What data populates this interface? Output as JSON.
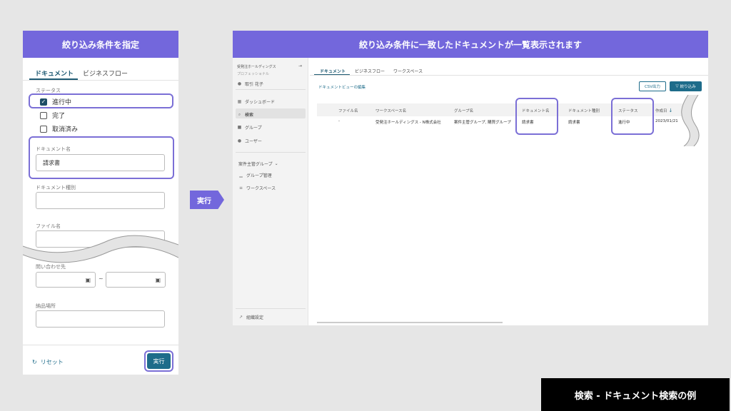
{
  "left_panel": {
    "header": "絞り込み条件を指定",
    "tabs": [
      "ドキュメント",
      "ビジネスフロー"
    ],
    "status_label": "ステータス",
    "status_options": [
      {
        "label": "進行中",
        "checked": true
      },
      {
        "label": "完了",
        "checked": false
      },
      {
        "label": "取消済み",
        "checked": false
      }
    ],
    "doc_name_label": "ドキュメント名",
    "doc_name_value": "請求書",
    "doc_type_label": "ドキュメント種別",
    "file_name_label": "ファイル名",
    "inquiry_label": "問い合わせ先",
    "range_separator": "~",
    "delivery_label": "納品場所",
    "reset_label": "リセット",
    "run_label": "実行"
  },
  "arrow_label": "実行",
  "right_panel": {
    "header": "絞り込み条件に一致したドキュメントが一覧表示されます",
    "sidebar": {
      "org_name": "受発注ホールディングス",
      "org_sub": "プロフェッショナル",
      "user": "取引 花子",
      "items": [
        "ダッシュボード",
        "検索",
        "グループ"
      ],
      "items2": [
        "ユーザー"
      ],
      "group_header": "案件主管グループ",
      "group_items": [
        "グループ管理",
        "ワークスペース"
      ],
      "footer": "組織設定"
    },
    "tabs": [
      "ドキュメント",
      "ビジネスフロー",
      "ワークスペース"
    ],
    "edit_view_link": "ドキュメントビューの編集",
    "csv_button": "CSV出力",
    "filter_button": "絞り込み",
    "table": {
      "headers": [
        "ファイル名",
        "ワークスペース名",
        "グループ名",
        "ドキュメント名",
        "ドキュメント種別",
        "ステータス",
        "作成日"
      ],
      "row": [
        "-",
        "受発注ホールディングス - N株式会社",
        "案件主管グループ, 購買グループ",
        "請求書",
        "請求書",
        "進行中",
        "2023/01/21"
      ]
    }
  },
  "caption": "検索 - ドキュメント検索の例"
}
